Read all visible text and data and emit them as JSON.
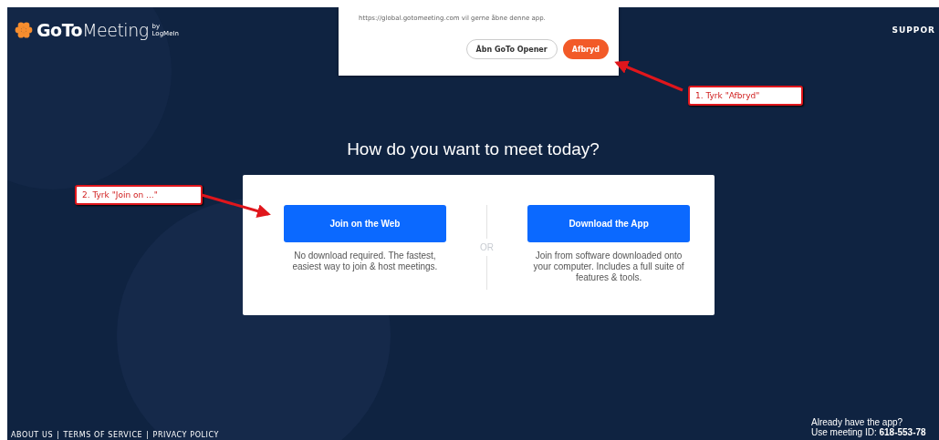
{
  "header": {
    "logo": "**GoTo**Meeting",
    "logo_byline": "by LogMeIn",
    "support_link": "SUPPOR"
  },
  "dialog": {
    "message": "https://global.gotomeeting.com vil gerne åbne denne app.",
    "buttons": [
      {
        "label": "Åbn GoTo Opener",
        "kind": "secondary"
      },
      {
        "label": "Afbryd",
        "kind": "primary"
      }
    ]
  },
  "heading": "How do you want to meet today?",
  "options": [
    {
      "button": "Join on the Web",
      "description": "No download required. The fastest, easiest way to join & host meetings."
    },
    {
      "button": "Download the App",
      "description": "Join from software downloaded onto your computer. Includes a full suite of features & tools."
    }
  ],
  "divider_label": "OR",
  "annotations": [
    "1. Tyrk \"Afbryd\"",
    "2. Tyrk \"Join on ...\""
  ],
  "footer": {
    "links": [
      "ABOUT US",
      "TERMS OF SERVICE",
      "PRIVACY POLICY"
    ],
    "separator": "|",
    "app_prompt": "Already have the app?",
    "meeting_id": "Use meeting ID: **618-553-78**"
  }
}
